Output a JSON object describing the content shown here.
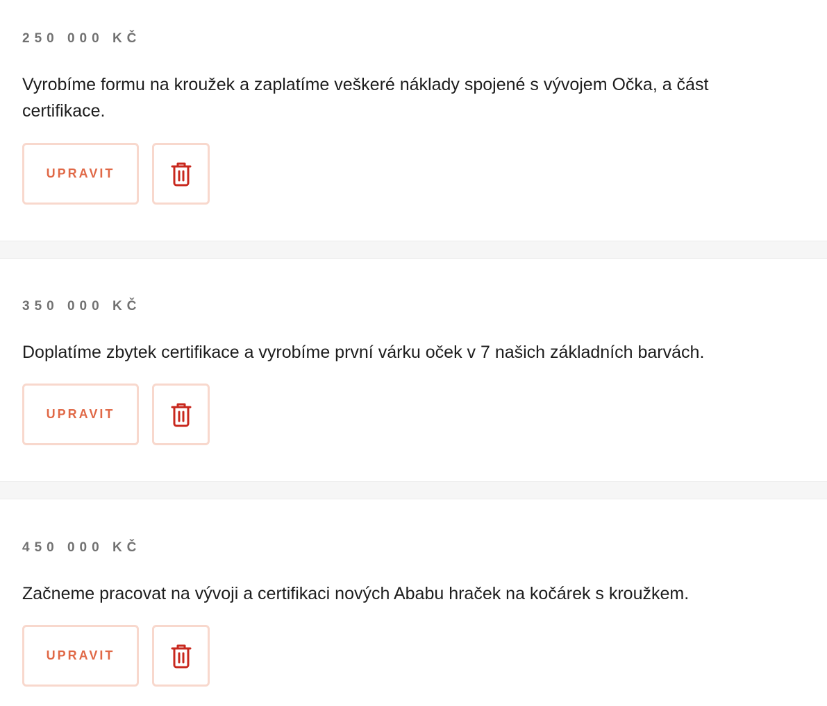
{
  "goals": [
    {
      "amount": "250 000 KČ",
      "description": "Vyrobíme formu na kroužek a zaplatíme veškeré náklady spojené s vývojem Očka, a část certifikace.",
      "edit_label": "UPRAVIT",
      "delete_icon": "trash-icon"
    },
    {
      "amount": "350 000 KČ",
      "description": "Doplatíme zbytek certifikace a vyrobíme první várku oček v 7 našich základních barvách.",
      "edit_label": "UPRAVIT",
      "delete_icon": "trash-icon"
    },
    {
      "amount": "450 000 KČ",
      "description": "Začneme pracovat na vývoji a certifikaci nových Ababu hraček na kočárek s kroužkem.",
      "edit_label": "UPRAVIT",
      "delete_icon": "trash-icon"
    }
  ],
  "colors": {
    "accent": "#e06846",
    "icon": "#c8281e",
    "button_border": "#f8d8cd",
    "amount_text": "#717171",
    "body_text": "#1d1d1d",
    "divider": "#f6f6f6"
  }
}
